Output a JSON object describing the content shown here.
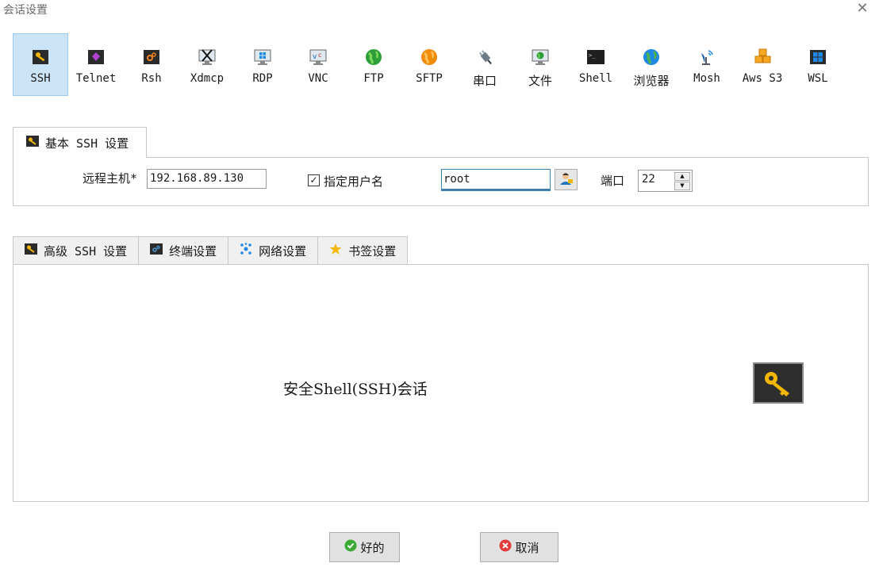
{
  "window": {
    "title": "会话设置"
  },
  "session_types": [
    {
      "label": "SSH",
      "icon": "key-icon",
      "active": true
    },
    {
      "label": "Telnet",
      "icon": "telnet-icon"
    },
    {
      "label": "Rsh",
      "icon": "rsh-icon"
    },
    {
      "label": "Xdmcp",
      "icon": "xdmcp-icon"
    },
    {
      "label": "RDP",
      "icon": "rdp-monitor-icon"
    },
    {
      "label": "VNC",
      "icon": "vnc-icon"
    },
    {
      "label": "FTP",
      "icon": "ftp-globe-icon"
    },
    {
      "label": "SFTP",
      "icon": "sftp-globe-icon"
    },
    {
      "label": "串口",
      "icon": "serial-plug-icon"
    },
    {
      "label": "文件",
      "icon": "file-monitor-icon"
    },
    {
      "label": "Shell",
      "icon": "shell-terminal-icon"
    },
    {
      "label": "浏览器",
      "icon": "browser-globe-icon"
    },
    {
      "label": "Mosh",
      "icon": "mosh-satellite-icon"
    },
    {
      "label": "Aws S3",
      "icon": "aws-cubes-icon"
    },
    {
      "label": "WSL",
      "icon": "windows-logo-icon"
    }
  ],
  "basic": {
    "tab_label": "基本 SSH 设置",
    "remote_host_label": "远程主机",
    "required_mark": "*",
    "remote_host_value": "192.168.89.130",
    "specify_username_label": "指定用户名",
    "specify_username_checked": true,
    "check_mark": "✓",
    "username_value": "root",
    "port_label": "端口",
    "port_value": "22"
  },
  "advanced_tabs": [
    {
      "label": "高级 SSH 设置",
      "icon": "key-icon"
    },
    {
      "label": "终端设置",
      "icon": "terminal-icon"
    },
    {
      "label": "网络设置",
      "icon": "network-icon"
    },
    {
      "label": "书签设置",
      "icon": "star-icon"
    }
  ],
  "description": "安全Shell(SSH)会话",
  "buttons": {
    "ok": "好的",
    "cancel": "取消"
  },
  "colors": {
    "active_bg": "#cce4f7",
    "ok_green": "#3aaa35",
    "cancel_red": "#e23b3b",
    "key_gold": "#f2b705"
  }
}
